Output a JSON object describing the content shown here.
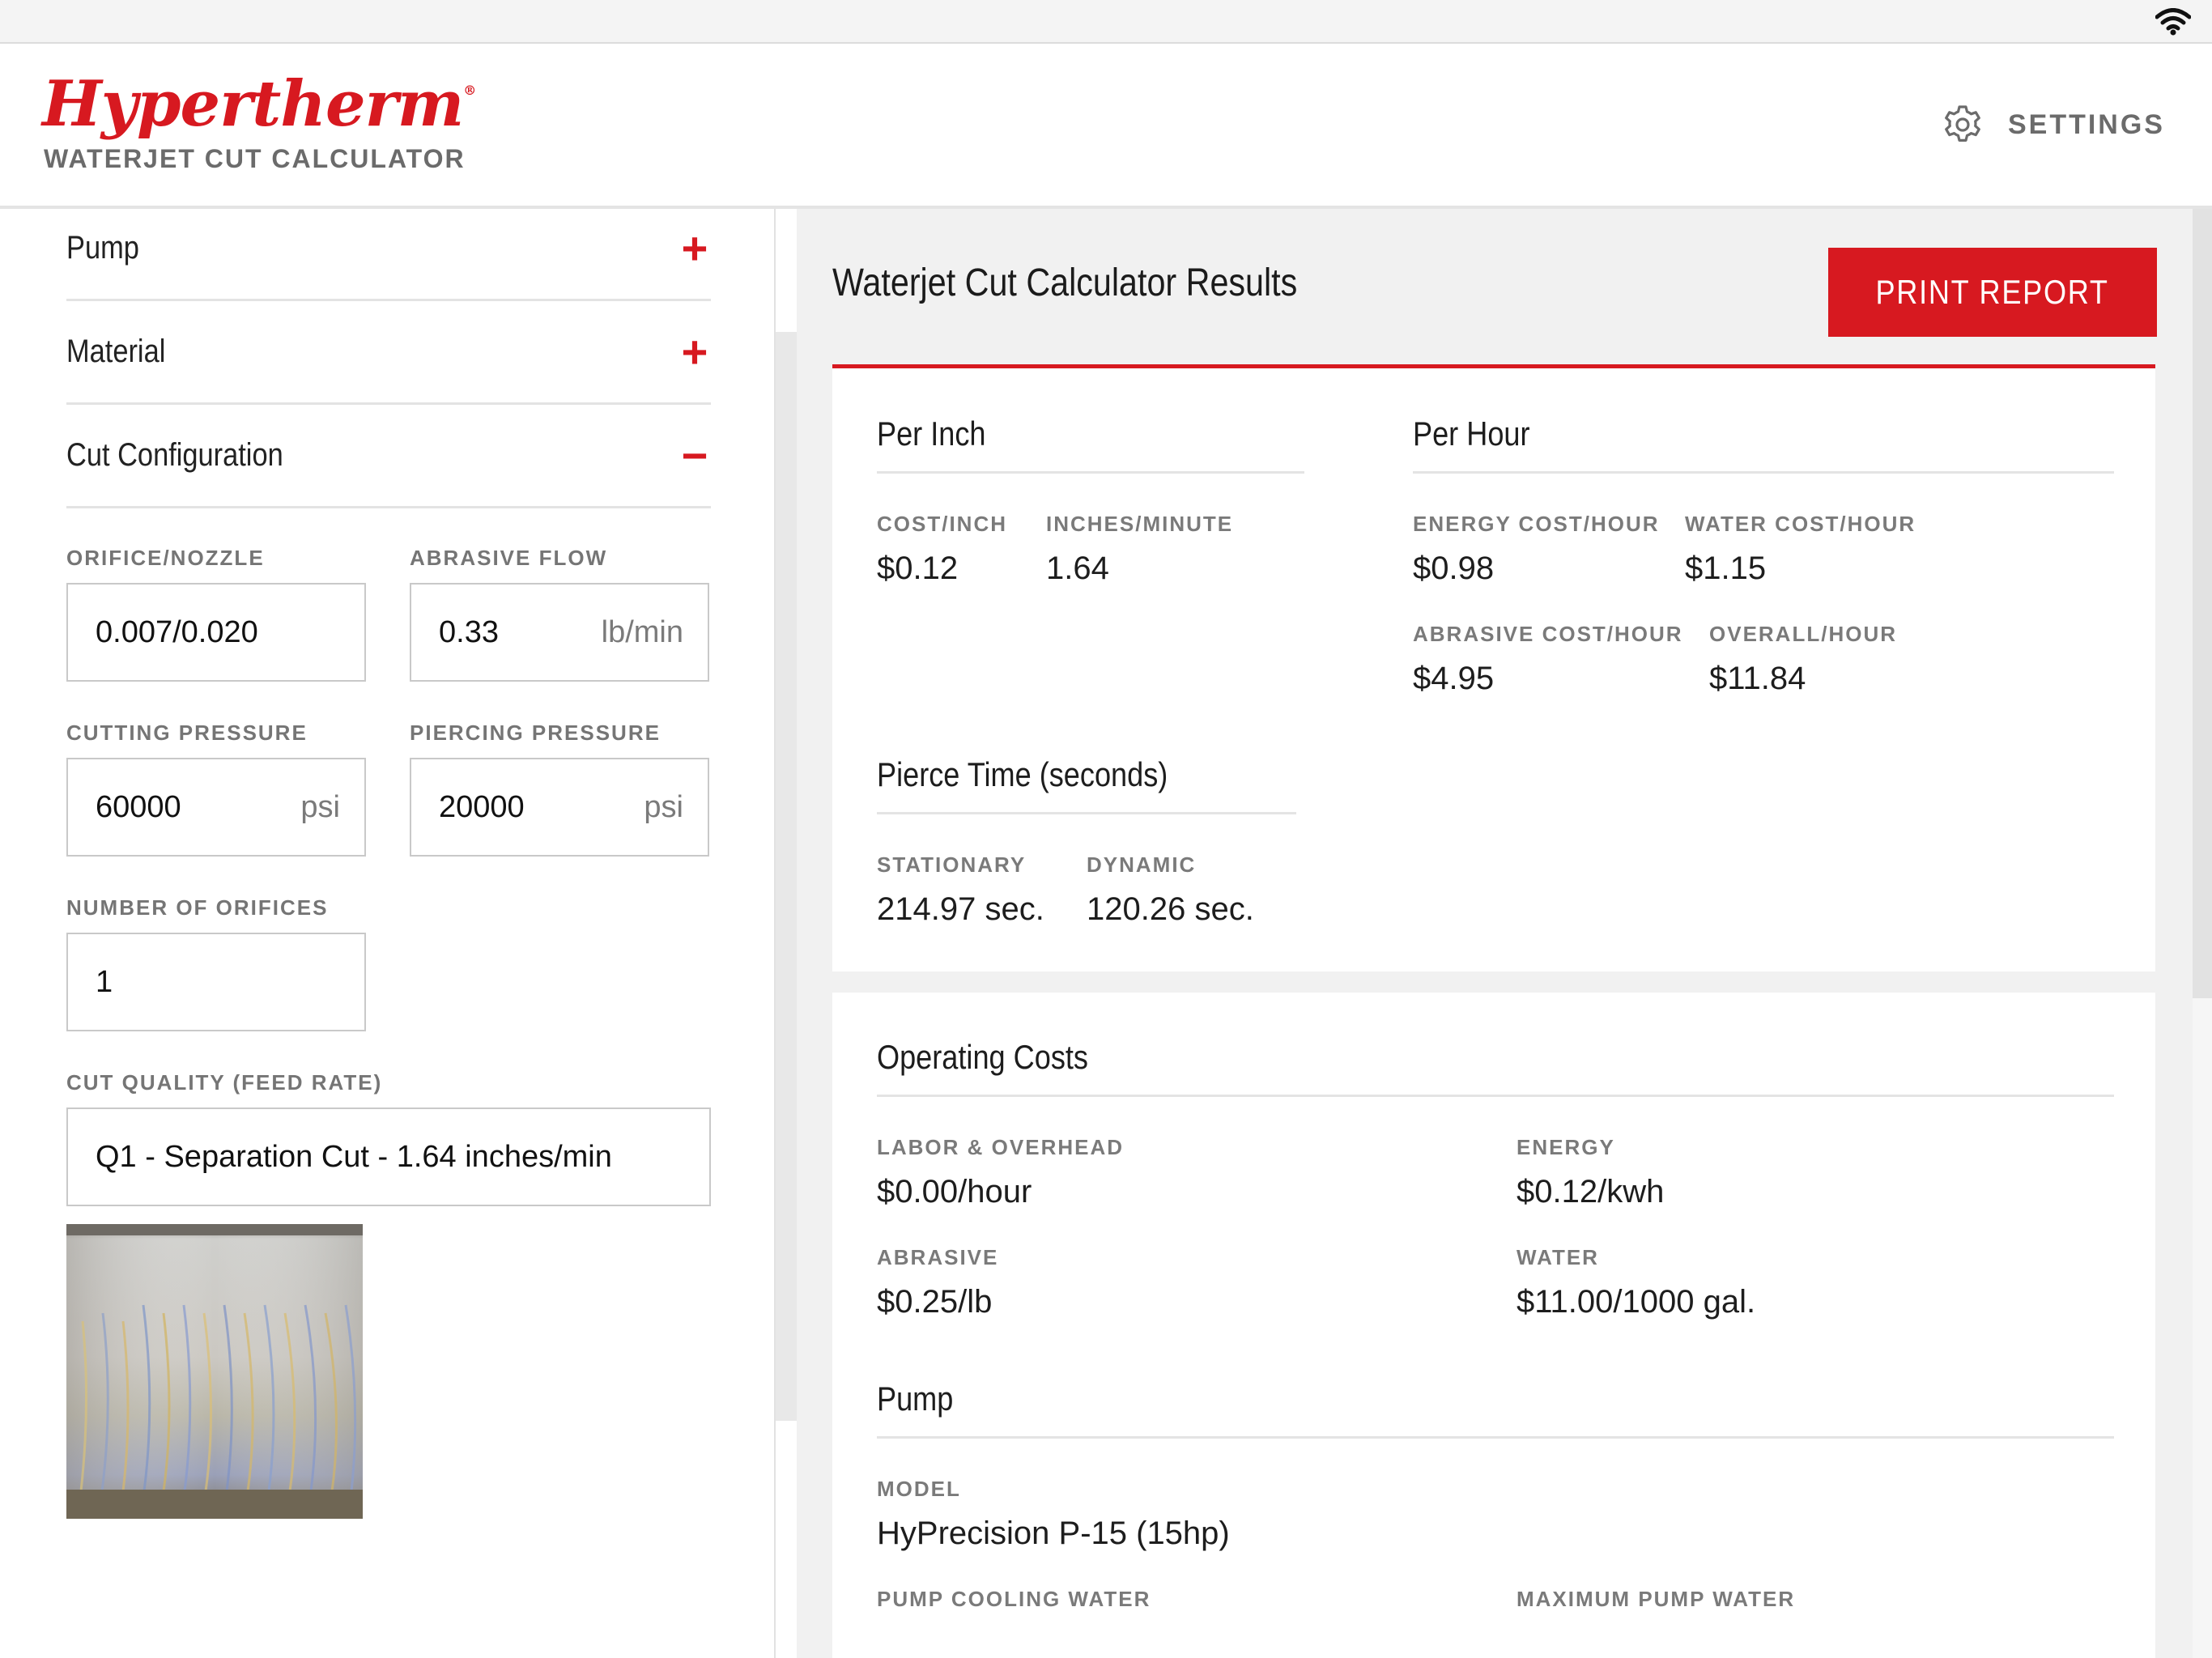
{
  "header": {
    "logo_text": "Hypertherm",
    "subtitle": "WATERJET CUT CALCULATOR",
    "settings_label": "SETTINGS"
  },
  "sidebar": {
    "sections": [
      {
        "label": "Pump",
        "state": "+"
      },
      {
        "label": "Material",
        "state": "+"
      },
      {
        "label": "Cut Configuration",
        "state": "−"
      }
    ],
    "fields": {
      "orifice": {
        "label": "ORIFICE/NOZZLE",
        "value": "0.007/0.020"
      },
      "abrasive_flow": {
        "label": "ABRASIVE FLOW",
        "value": "0.33",
        "unit": "lb/min"
      },
      "cutting_pressure": {
        "label": "CUTTING PRESSURE",
        "value": "60000",
        "unit": "psi"
      },
      "piercing_pressure": {
        "label": "PIERCING PRESSURE",
        "value": "20000",
        "unit": "psi"
      },
      "orifices": {
        "label": "NUMBER OF ORIFICES",
        "value": "1"
      },
      "cut_quality": {
        "label": "CUT QUALITY (FEED RATE)",
        "value": "Q1 - Separation Cut - 1.64 inches/min"
      }
    }
  },
  "results": {
    "title": "Waterjet Cut Calculator Results",
    "print_label": "PRINT REPORT",
    "per_inch": {
      "heading": "Per Inch",
      "cost_inch": {
        "label": "COST/INCH",
        "value": "$0.12"
      },
      "inches_minute": {
        "label": "INCHES/MINUTE",
        "value": "1.64"
      }
    },
    "per_hour": {
      "heading": "Per Hour",
      "energy": {
        "label": "ENERGY COST/HOUR",
        "value": "$0.98"
      },
      "water": {
        "label": "WATER COST/HOUR",
        "value": "$1.15"
      },
      "abrasive": {
        "label": "ABRASIVE COST/HOUR",
        "value": "$4.95"
      },
      "overall": {
        "label": "OVERALL/HOUR",
        "value": "$11.84"
      }
    },
    "pierce": {
      "heading": "Pierce Time (seconds)",
      "stationary": {
        "label": "STATIONARY",
        "value": "214.97 sec."
      },
      "dynamic": {
        "label": "DYNAMIC",
        "value": "120.26 sec."
      }
    },
    "operating": {
      "heading": "Operating Costs",
      "labor": {
        "label": "LABOR & OVERHEAD",
        "value": "$0.00/hour"
      },
      "energy": {
        "label": "ENERGY",
        "value": "$0.12/kwh"
      },
      "abrasive": {
        "label": "ABRASIVE",
        "value": "$0.25/lb"
      },
      "water": {
        "label": "WATER",
        "value": "$11.00/1000 gal."
      }
    },
    "pump": {
      "heading": "Pump",
      "model": {
        "label": "MODEL",
        "value": "HyPrecision P-15 (15hp)"
      },
      "cooling": {
        "label": "PUMP COOLING WATER"
      },
      "max_water": {
        "label": "MAXIMUM PUMP WATER"
      }
    }
  },
  "colors": {
    "brand_red": "#d71920",
    "label_gray": "#757575"
  }
}
